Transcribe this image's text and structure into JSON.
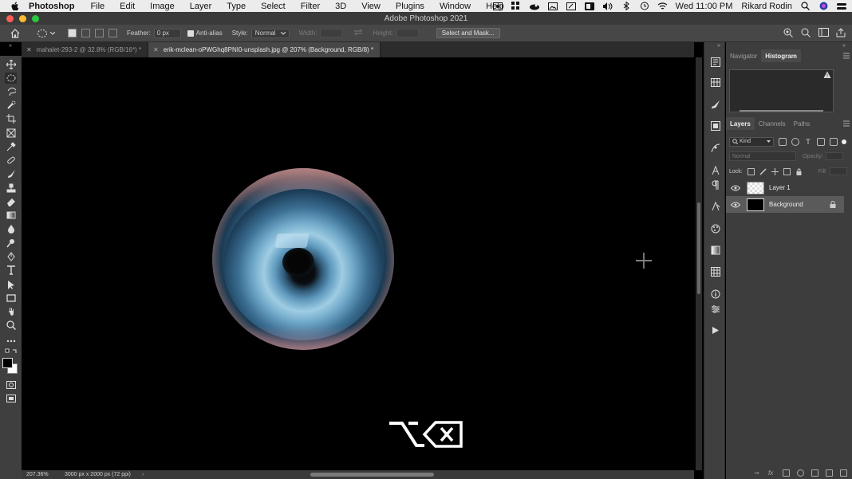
{
  "menubar": {
    "app_name": "Photoshop",
    "items": [
      "File",
      "Edit",
      "Image",
      "Layer",
      "Type",
      "Select",
      "Filter",
      "3D",
      "View",
      "Plugins",
      "Window",
      "Help"
    ],
    "clock": "Wed 11:00 PM",
    "user": "Rikard Rodin",
    "status_icons": [
      "screen-record-icon",
      "grid-icon",
      "creative-cloud-icon",
      "image-icon",
      "pen-icon",
      "window-icon",
      "volume-icon",
      "bluetooth-icon",
      "time-machine-icon",
      "wifi-icon"
    ]
  },
  "window": {
    "title": "Adobe Photoshop 2021"
  },
  "options": {
    "feather_label": "Feather:",
    "feather_value": "0 px",
    "antialias_label": "Anti-alias",
    "style_label": "Style:",
    "style_value": "Normal",
    "width_label": "Width:",
    "height_label": "Height:",
    "select_mask_label": "Select and Mask..."
  },
  "tabs": [
    {
      "label": "mahalet-293-2 @ 32.8% (RGB/16*) *",
      "active": false
    },
    {
      "label": "erik-mclean-oPWGhq8PNI0-unsplash.jpg @ 207% (Background, RGB/8) *",
      "active": true
    }
  ],
  "tools": [
    "move-tool",
    "elliptical-marquee-tool",
    "lasso-tool",
    "quick-select-tool",
    "crop-tool",
    "frame-tool",
    "eyedropper-tool",
    "healing-brush-tool",
    "brush-tool",
    "clone-stamp-tool",
    "history-brush-tool",
    "eraser-tool",
    "gradient-tool",
    "blur-tool",
    "dodge-tool",
    "pen-tool",
    "type-tool",
    "path-select-tool",
    "rectangle-tool",
    "hand-tool",
    "zoom-tool",
    "more-tools"
  ],
  "canvas": {
    "keyboard_overlay": "⌥⌫"
  },
  "status": {
    "zoom": "207.36%",
    "doc_info": "3000 px x 2000 px (72 ppi)"
  },
  "panels": {
    "top_tabs": [
      "Navigator",
      "Histogram"
    ],
    "top_active": "Histogram",
    "layer_tabs": [
      "Layers",
      "Channels",
      "Paths"
    ],
    "layer_active": "Layers",
    "kind_label": "Kind",
    "blend_mode": "Normal",
    "opacity_label": "Opacity:",
    "lock_label": "Lock:",
    "fill_label": "Fill:",
    "layers": [
      {
        "name": "Layer 1",
        "visible": true,
        "selected": false,
        "locked": false
      },
      {
        "name": "Background",
        "visible": true,
        "selected": true,
        "locked": true
      }
    ]
  },
  "colors": {
    "accent": "#4a4a4a",
    "traffic_red": "#fe5f57",
    "traffic_yellow": "#febc2e",
    "traffic_green": "#28c840"
  }
}
